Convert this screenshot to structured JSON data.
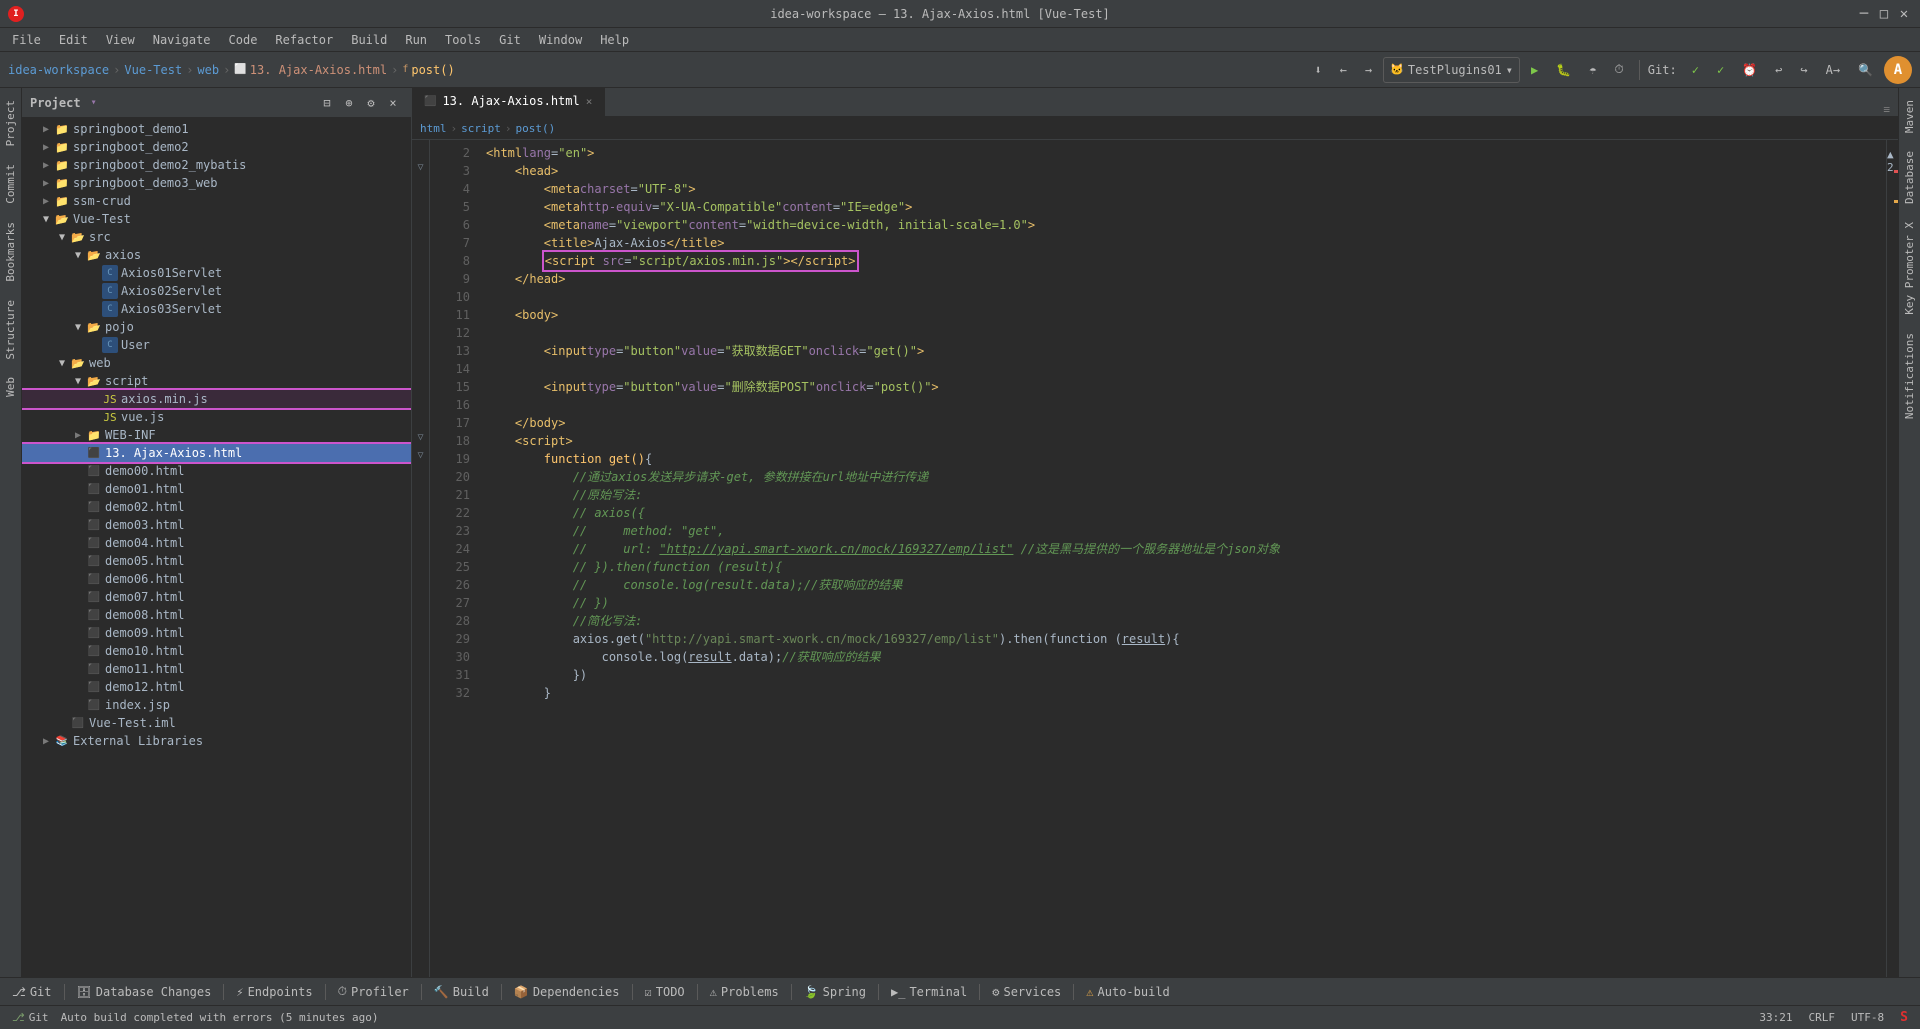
{
  "window": {
    "title": "idea-workspace – 13. Ajax-Axios.html [Vue-Test]",
    "controls": [
      "–",
      "□",
      "×"
    ]
  },
  "menubar": {
    "items": [
      "🍎",
      "File",
      "Edit",
      "View",
      "Navigate",
      "Code",
      "Refactor",
      "Build",
      "Run",
      "Tools",
      "Git",
      "Window",
      "Help"
    ]
  },
  "toolbar": {
    "breadcrumb": [
      "idea-workspace",
      "Vue-Test",
      "web",
      "13. Ajax-Axios.html",
      "post()"
    ],
    "run_config": "TestPlugins01",
    "git_label": "Git:"
  },
  "project_panel": {
    "title": "Project",
    "items": [
      {
        "id": "springboot_demo1",
        "label": "springboot_demo1",
        "type": "folder",
        "indent": 1,
        "open": false
      },
      {
        "id": "springboot_demo2",
        "label": "springboot_demo2",
        "type": "folder",
        "indent": 1,
        "open": false
      },
      {
        "id": "springboot_demo2_mybatis",
        "label": "springboot_demo2_mybatis",
        "type": "folder",
        "indent": 1,
        "open": false
      },
      {
        "id": "springboot_demo3_web",
        "label": "springboot_demo3_web",
        "type": "folder",
        "indent": 1,
        "open": false
      },
      {
        "id": "ssm-crud",
        "label": "ssm-crud",
        "type": "folder",
        "indent": 1,
        "open": false
      },
      {
        "id": "vue-test",
        "label": "Vue-Test",
        "type": "folder",
        "indent": 1,
        "open": true
      },
      {
        "id": "src",
        "label": "src",
        "type": "folder",
        "indent": 2,
        "open": true
      },
      {
        "id": "axios",
        "label": "axios",
        "type": "folder",
        "indent": 3,
        "open": true
      },
      {
        "id": "Axios01Servlet",
        "label": "Axios01Servlet",
        "type": "java-c",
        "indent": 4
      },
      {
        "id": "Axios02Servlet",
        "label": "Axios02Servlet",
        "type": "java-c",
        "indent": 4
      },
      {
        "id": "Axios03Servlet",
        "label": "Axios03Servlet",
        "type": "java-c",
        "indent": 4
      },
      {
        "id": "pojo",
        "label": "pojo",
        "type": "folder",
        "indent": 3,
        "open": true
      },
      {
        "id": "User",
        "label": "User",
        "type": "java-c",
        "indent": 4
      },
      {
        "id": "web",
        "label": "web",
        "type": "folder",
        "indent": 2,
        "open": true
      },
      {
        "id": "script",
        "label": "script",
        "type": "folder",
        "indent": 3,
        "open": true
      },
      {
        "id": "axios_min_js",
        "label": "axios.min.js",
        "type": "js",
        "indent": 4,
        "highlight": true
      },
      {
        "id": "vue_js",
        "label": "vue.js",
        "type": "js",
        "indent": 4
      },
      {
        "id": "WEB-INF",
        "label": "WEB-INF",
        "type": "folder",
        "indent": 3,
        "open": false
      },
      {
        "id": "ajax_axios_html",
        "label": "13. Ajax-Axios.html",
        "type": "html",
        "indent": 3,
        "selected": true
      },
      {
        "id": "demo00",
        "label": "demo00.html",
        "type": "html",
        "indent": 3
      },
      {
        "id": "demo01",
        "label": "demo01.html",
        "type": "html",
        "indent": 3
      },
      {
        "id": "demo02",
        "label": "demo02.html",
        "type": "html",
        "indent": 3
      },
      {
        "id": "demo03",
        "label": "demo03.html",
        "type": "html",
        "indent": 3
      },
      {
        "id": "demo04",
        "label": "demo04.html",
        "type": "html",
        "indent": 3
      },
      {
        "id": "demo05",
        "label": "demo05.html",
        "type": "html",
        "indent": 3
      },
      {
        "id": "demo06",
        "label": "demo06.html",
        "type": "html",
        "indent": 3
      },
      {
        "id": "demo07",
        "label": "demo07.html",
        "type": "html",
        "indent": 3
      },
      {
        "id": "demo08",
        "label": "demo08.html",
        "type": "html",
        "indent": 3
      },
      {
        "id": "demo09",
        "label": "demo09.html",
        "type": "html",
        "indent": 3
      },
      {
        "id": "demo10",
        "label": "demo10.html",
        "type": "html",
        "indent": 3
      },
      {
        "id": "demo11",
        "label": "demo11.html",
        "type": "html",
        "indent": 3
      },
      {
        "id": "demo12",
        "label": "demo12.html",
        "type": "html",
        "indent": 3
      },
      {
        "id": "index_jsp",
        "label": "index.jsp",
        "type": "jsp",
        "indent": 3
      },
      {
        "id": "vue_test_iml",
        "label": "Vue-Test.iml",
        "type": "iml",
        "indent": 2
      },
      {
        "id": "external_libs",
        "label": "External Libraries",
        "type": "folder",
        "indent": 1,
        "open": false
      }
    ]
  },
  "editor": {
    "tab": "13. Ajax-Axios.html",
    "lines": [
      {
        "num": 2,
        "fold": false,
        "code": "<html_tag>&lt;html</html_tag> <attr_name>lang</attr_name>=<attr_val>\"en\"</attr_val><html_tag>&gt;</html_tag>"
      },
      {
        "num": 3,
        "fold": true,
        "code": "    <html_tag>&lt;head&gt;</html_tag>"
      },
      {
        "num": 4,
        "fold": false,
        "code": "        <html_tag>&lt;meta</html_tag> <attr_name>charset</attr_name>=<attr_val>\"UTF-8\"</attr_val><html_tag>&gt;</html_tag>"
      },
      {
        "num": 5,
        "fold": false,
        "code": "        <html_tag>&lt;meta</html_tag> <attr_name>http-equiv</attr_name>=<attr_val>\"X-UA-Compatible\"</attr_val> <attr_name>content</attr_name>=<attr_val>\"IE=edge\"</attr_val><html_tag>&gt;</html_tag>"
      },
      {
        "num": 6,
        "fold": false,
        "code": "        <html_tag>&lt;meta</html_tag> <attr_name>name</attr_name>=<attr_val>\"viewport\"</attr_val> <attr_name>content</attr_name>=<attr_val>\"width=device-width, initial-scale=1.0\"</attr_val><html_tag>&gt;</html_tag>"
      },
      {
        "num": 7,
        "fold": false,
        "code": "        <html_tag>&lt;title&gt;</html_tag><text>Ajax-Axios</text><html_tag>&lt;/title&gt;</html_tag>"
      },
      {
        "num": 8,
        "fold": false,
        "code": "        <highlight_script>&lt;script</highlight_script> <attr_name>src</attr_name>=<attr_val>\"script/axios.min.js\"</attr_val><highlight_script>&gt;&lt;/script&gt;</highlight_script>"
      },
      {
        "num": 9,
        "fold": false,
        "code": "    <html_tag>&lt;/head&gt;</html_tag>"
      },
      {
        "num": 10,
        "fold": false,
        "code": ""
      },
      {
        "num": 11,
        "fold": false,
        "code": "    <html_tag>&lt;body&gt;</html_tag>"
      },
      {
        "num": 12,
        "fold": false,
        "code": ""
      },
      {
        "num": 13,
        "fold": false,
        "code": "        <html_tag>&lt;input</html_tag> <attr_name>type</attr_name>=<attr_val>\"button\"</attr_val> <attr_name>value</attr_name>=<attr_val>\"获取数据GET\"</attr_val> <attr_name>onclick</attr_name>=<attr_val>\"get()\"</attr_val><html_tag>&gt;</html_tag>"
      },
      {
        "num": 14,
        "fold": false,
        "code": ""
      },
      {
        "num": 15,
        "fold": false,
        "code": "        <html_tag>&lt;input</html_tag> <attr_name>type</attr_name>=<attr_val>\"button\"</attr_val> <attr_name>value</attr_name>=<attr_val>\"删除数据POST\"</attr_val> <attr_name>onclick</attr_name>=<attr_val>\"post()\"</attr_val><html_tag>&gt;</html_tag>"
      },
      {
        "num": 16,
        "fold": false,
        "code": ""
      },
      {
        "num": 17,
        "fold": false,
        "code": "    <html_tag>&lt;/body&gt;</html_tag>"
      },
      {
        "num": 18,
        "fold": true,
        "code": "    <html_tag>&lt;script&gt;</html_tag>"
      },
      {
        "num": 19,
        "fold": false,
        "code": "        <func>function get()</func>{"
      },
      {
        "num": 20,
        "fold": false,
        "code": "            <comment>//通过axios发送异步请求-get, 参数拼接在url地址中进行传递</comment>"
      },
      {
        "num": 21,
        "fold": false,
        "code": "            <comment>//原始写法:</comment>"
      },
      {
        "num": 22,
        "fold": false,
        "code": "            <comment>// axios({</comment>"
      },
      {
        "num": 23,
        "fold": false,
        "code": "            <comment>//     method: \"get\",</comment>"
      },
      {
        "num": 24,
        "fold": false,
        "code": "            <comment>//     url: <url>\"http://yapi.smart-xwork.cn/mock/169327/emp/list\"</url> //这是黑马提供的一个服务器地址是个json对象</comment>"
      },
      {
        "num": 25,
        "fold": false,
        "code": "            <comment>// }).then(function (result){</comment>"
      },
      {
        "num": 26,
        "fold": false,
        "code": "            <comment>//     console.log(result.data);//获取响应的结果</comment>"
      },
      {
        "num": 27,
        "fold": false,
        "code": "            <comment>// })</comment>"
      },
      {
        "num": 28,
        "fold": false,
        "code": "            <comment>//简化写法:</comment>"
      },
      {
        "num": 29,
        "fold": false,
        "code": "            <text>axios.get(</text><string>\"http://yapi.smart-xwork.cn/mock/169327/emp/list\"</string><text>).then(function (</text><underline>result</underline><text>){</text>"
      },
      {
        "num": 30,
        "fold": false,
        "code": "                <text>console.log(</text><underline>result</underline><text>.data);</text><comment>//获取响应的结果</comment>"
      },
      {
        "num": 31,
        "fold": false,
        "code": "            })"
      },
      {
        "num": 32,
        "fold": false,
        "code": "        }"
      }
    ],
    "path_bar": [
      "html",
      "script",
      "post()"
    ]
  },
  "right_side_tabs": [
    "Maven",
    "Database",
    "Key Promoter X",
    "Notifications"
  ],
  "bottom_bar": {
    "tabs": [
      "Git",
      "Database Changes",
      "Endpoints",
      "Profiler",
      "Build",
      "Dependencies",
      "TODO",
      "Problems",
      "Spring",
      "Terminal",
      "Services",
      "Auto-build"
    ]
  },
  "status_bar": {
    "message": "Auto build completed with errors (5 minutes ago)",
    "position": "33:21",
    "encoding": "CRLF",
    "charset": "UTF-8"
  }
}
